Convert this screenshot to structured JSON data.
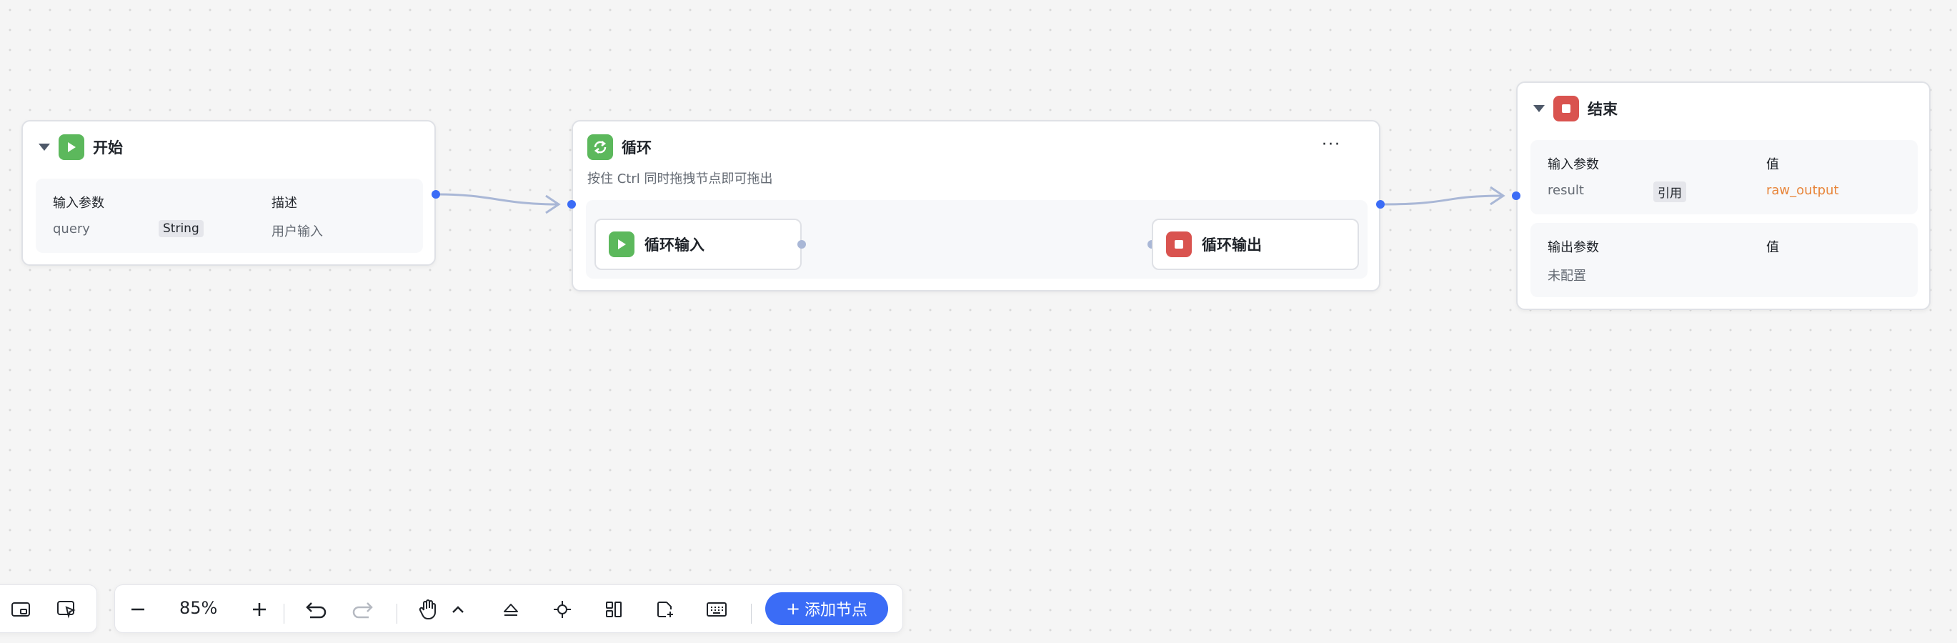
{
  "start_node": {
    "title": "开始",
    "header_params": "输入参数",
    "header_desc": "描述",
    "param_name": "query",
    "param_type": "String",
    "param_desc": "用户输入"
  },
  "loop_node": {
    "title": "循环",
    "hint": "按住 Ctrl 同时拖拽节点即可拖出",
    "more_label": "···",
    "loop_input_title": "循环输入",
    "loop_output_title": "循环输出"
  },
  "end_node": {
    "title": "结束",
    "input_header": "输入参数",
    "value_header": "值",
    "input_name": "result",
    "input_kind": "引用",
    "input_value": "raw_output",
    "output_header": "输出参数",
    "output_value_header": "值",
    "output_empty": "未配置"
  },
  "toolbar": {
    "zoom_level": "85%",
    "add_node_label": "添加节点",
    "add_node_icon": "+"
  },
  "colors": {
    "accent": "#3b6cf6",
    "start_icon": "#5cb85c",
    "end_icon": "#d9534f",
    "reference_value": "#e8853a"
  },
  "icons": [
    "play-icon",
    "loop-icon",
    "stop-icon",
    "caret-down-icon",
    "minus-icon",
    "plus-icon",
    "undo-icon",
    "redo-icon",
    "hand-icon",
    "chevron-up-icon",
    "eject-icon",
    "focus-icon",
    "layout-icon",
    "add-note-icon",
    "keyboard-icon",
    "minimap-icon",
    "select-icon"
  ]
}
